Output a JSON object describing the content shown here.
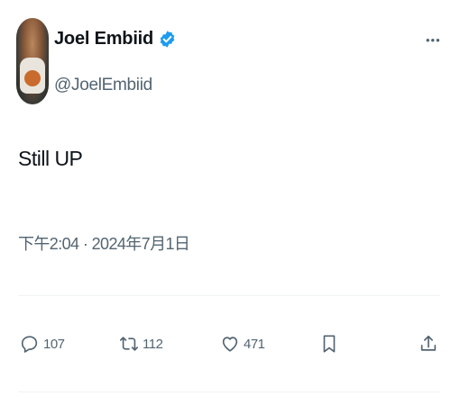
{
  "author": {
    "name": "Joel Embiid",
    "handle": "@JoelEmbiid",
    "verified": true
  },
  "tweet": {
    "text": "Still UP",
    "timestamp": "下午2:04 · 2024年7月1日"
  },
  "actions": {
    "replies": "107",
    "retweets": "112",
    "likes": "471"
  },
  "colors": {
    "text": "#0f1419",
    "secondary": "#536471",
    "verified": "#1d9bf0",
    "divider": "#eff3f4"
  },
  "icons": {
    "more": "more-icon",
    "reply": "reply-icon",
    "retweet": "retweet-icon",
    "like": "heart-icon",
    "bookmark": "bookmark-icon",
    "share": "share-icon",
    "verified": "verified-badge-icon"
  }
}
